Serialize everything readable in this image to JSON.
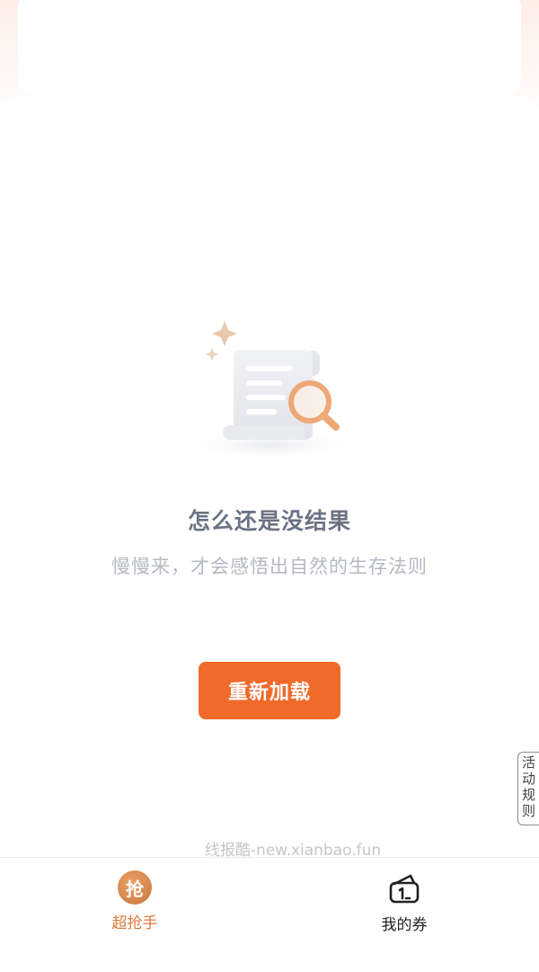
{
  "empty_state": {
    "title": "怎么还是没结果",
    "subtitle": "慢慢来，才会感悟出自然的生存法则",
    "illustration_icon": "search-document-icon"
  },
  "reload_button": {
    "label": "重新加载"
  },
  "rules_tab": {
    "label": "活动规则"
  },
  "watermark": "线报酷-new.xianbao.fun",
  "tab_bar": {
    "items": [
      {
        "label": "超抢手",
        "icon": "grab-badge-icon",
        "glyph": "抢",
        "active": true
      },
      {
        "label": "我的券",
        "icon": "wallet-icon",
        "active": false
      }
    ]
  },
  "colors": {
    "accent": "#f06a2a",
    "active_tab": "#e07a3c",
    "title_text": "#6c7385",
    "subtitle_text": "#b4b8c2"
  }
}
